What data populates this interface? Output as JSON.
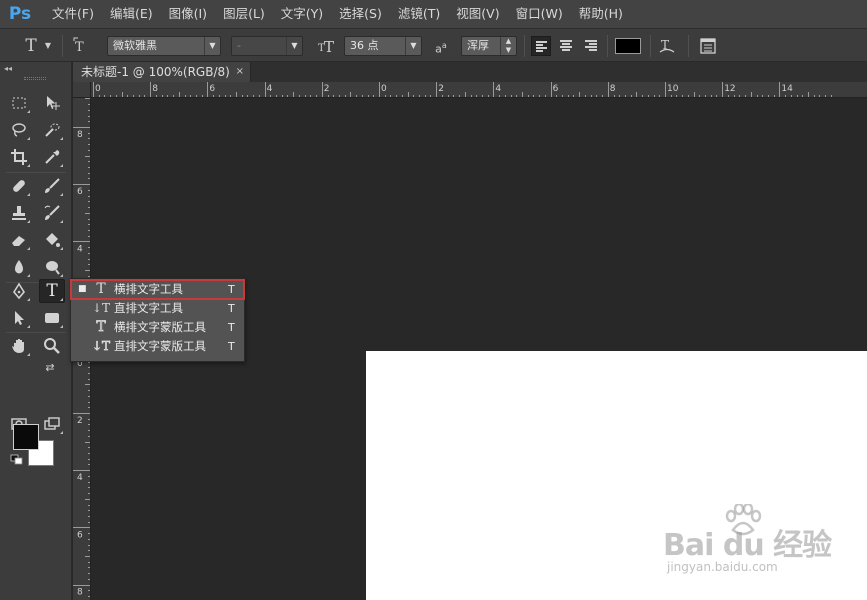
{
  "app": {
    "logo": "Ps"
  },
  "menu": [
    "文件(F)",
    "编辑(E)",
    "图像(I)",
    "图层(L)",
    "文字(Y)",
    "选择(S)",
    "滤镜(T)",
    "视图(V)",
    "窗口(W)",
    "帮助(H)"
  ],
  "options_bar": {
    "font_family": "微软雅黑",
    "font_style": "-",
    "font_size": "36 点",
    "antialias": "浑厚",
    "antialias_prefix": "a",
    "antialias_suffix": "a",
    "text_color": "#000000"
  },
  "document_tab": {
    "title": "未标题-1 @ 100%(RGB/8)",
    "close": "×"
  },
  "ruler_top": [
    "0",
    "8",
    "6",
    "4",
    "2",
    "0",
    "2",
    "4",
    "6",
    "8",
    "10",
    "12",
    "14"
  ],
  "ruler_left": [
    "8",
    "6",
    "4",
    "2",
    "0",
    "2",
    "4",
    "6",
    "8"
  ],
  "toolbar": {
    "collapse": "◂◂",
    "foreground_color": "#0a0a0a",
    "background_color": "#ffffff"
  },
  "flyout": {
    "items": [
      {
        "label": "横排文字工具",
        "shortcut": "T",
        "icon": "T",
        "selected": true,
        "bullet": "■"
      },
      {
        "label": "直排文字工具",
        "shortcut": "T",
        "icon": "↓T",
        "selected": false,
        "bullet": ""
      },
      {
        "label": "横排文字蒙版工具",
        "shortcut": "T",
        "icon": "T",
        "selected": false,
        "bullet": ""
      },
      {
        "label": "直排文字蒙版工具",
        "shortcut": "T",
        "icon": "↓T",
        "selected": false,
        "bullet": ""
      }
    ]
  },
  "watermark": {
    "logo": "Bai du 经验",
    "url": "jingyan.baidu.com"
  }
}
